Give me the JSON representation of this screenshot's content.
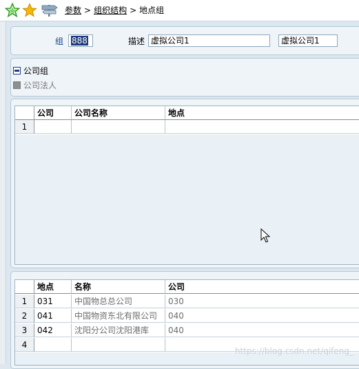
{
  "breadcrumb": {
    "item1": "参数",
    "item2": "组织结构",
    "item3": "地点组",
    "separator": ">"
  },
  "form": {
    "group_label": "组",
    "group_value": "888",
    "desc_label": "描述",
    "desc_value": "虚拟公司1",
    "desc_value2": "虚拟公司1"
  },
  "options": {
    "company_group": "公司组",
    "company_legal": "公司法人"
  },
  "grid1": {
    "headers": [
      "公司",
      "公司名称",
      "地点"
    ],
    "rows": [
      {
        "num": "1",
        "c1": "",
        "c2": "",
        "c3": ""
      }
    ]
  },
  "grid2": {
    "headers": [
      "地点",
      "名称",
      "公司"
    ],
    "rows": [
      {
        "num": "1",
        "c1": "031",
        "c2": "中国物总总公司",
        "c3": "030"
      },
      {
        "num": "2",
        "c1": "041",
        "c2": "中国物资东北有限公司",
        "c3": "040"
      },
      {
        "num": "3",
        "c1": "042",
        "c2": "沈阳分公司沈阳港库",
        "c3": "040"
      },
      {
        "num": "4",
        "c1": "",
        "c2": "",
        "c3": ""
      }
    ]
  },
  "watermark": "https://blog.csdn.net/qifeng_"
}
